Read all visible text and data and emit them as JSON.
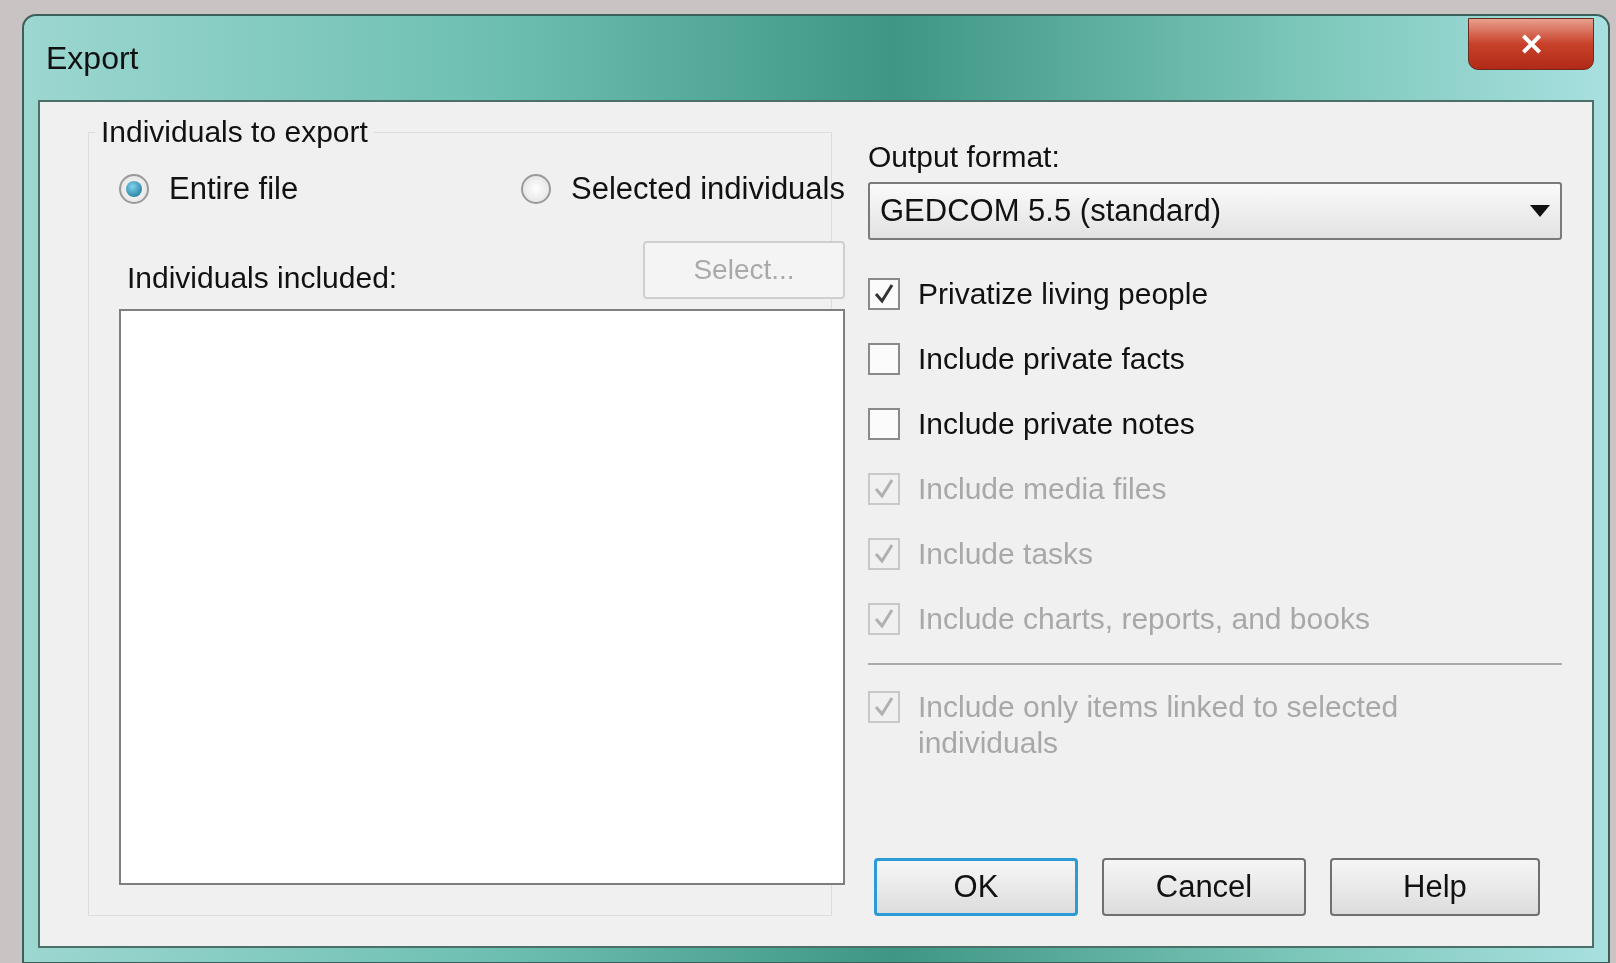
{
  "window": {
    "title": "Export",
    "close_label": "✕"
  },
  "individuals_group": {
    "title": "Individuals to export",
    "radios": [
      {
        "label": "Entire file",
        "selected": true
      },
      {
        "label": "Selected individuals",
        "selected": false
      }
    ],
    "select_button": {
      "label": "Select...",
      "disabled": true
    },
    "list_label": "Individuals included:"
  },
  "output_format": {
    "label": "Output format:",
    "value": "GEDCOM 5.5 (standard)"
  },
  "options": [
    {
      "label": "Privatize living people",
      "checked": true,
      "disabled": false
    },
    {
      "label": "Include private facts",
      "checked": false,
      "disabled": false
    },
    {
      "label": "Include private notes",
      "checked": false,
      "disabled": false
    },
    {
      "label": "Include media files",
      "checked": true,
      "disabled": true
    },
    {
      "label": "Include tasks",
      "checked": true,
      "disabled": true
    },
    {
      "label": "Include charts, reports, and books",
      "checked": true,
      "disabled": true
    }
  ],
  "linked_option": {
    "label": "Include only items linked  to selected individuals",
    "checked": true,
    "disabled": true
  },
  "buttons": [
    {
      "label": "OK",
      "default": true
    },
    {
      "label": "Cancel",
      "default": false
    },
    {
      "label": "Help",
      "default": false
    }
  ]
}
